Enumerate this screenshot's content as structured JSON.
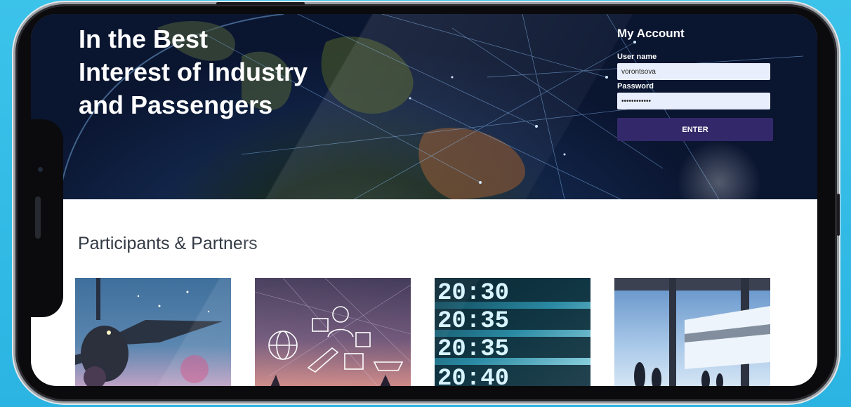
{
  "hero": {
    "title_lines": [
      "In the Best",
      "Interest of Industry",
      "and Passengers"
    ]
  },
  "account": {
    "title": "My Account",
    "username_label": "User name",
    "username_value": "vorontsova",
    "password_label": "Password",
    "password_value": "••••••••••••",
    "enter_label": "ENTER"
  },
  "partners": {
    "title": "Participants & Partners",
    "cards": [
      {
        "image": "airplane-night-image"
      },
      {
        "image": "logistics-network-image"
      },
      {
        "image": "departure-board-image",
        "board_text": [
          "20:30",
          "20:35",
          "20:35",
          "20:40"
        ]
      },
      {
        "image": "train-platform-image"
      }
    ]
  },
  "colors": {
    "accent": "#33286a",
    "background": "#2bb4e2",
    "input_bg": "#e9eefc"
  }
}
